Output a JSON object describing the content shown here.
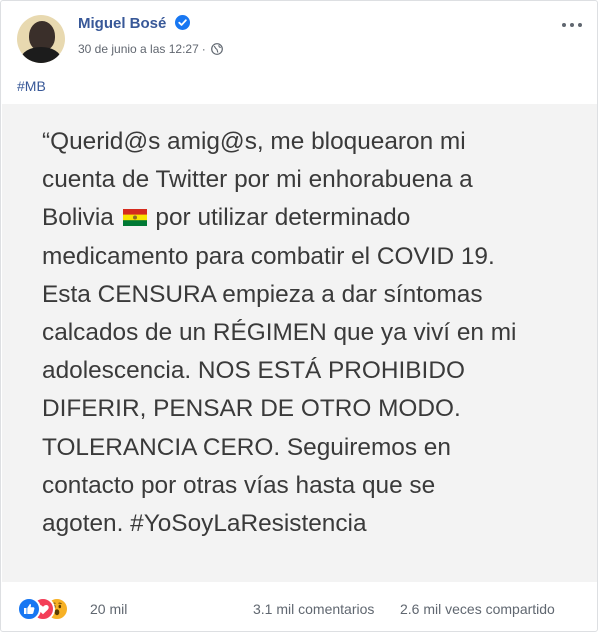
{
  "post": {
    "author": "Miguel Bosé",
    "timestamp": "30 de junio a las 12:27",
    "separator": "·",
    "privacy_icon": "globe-icon",
    "verified_icon": "verified-badge-icon",
    "hashtag": "#MB"
  },
  "image_text": {
    "lines": [
      "“Querid@s amig@s, me bloquearon mi",
      "cuenta de Twitter por mi enhorabuena a",
      "Bolivia",
      " por utilizar determinado",
      "medicamento para combatir el COVID 19.",
      "Esta CENSURA empieza a dar síntomas",
      "calcados de un RÉGIMEN que ya viví en mi",
      "adolescencia. NOS ESTÁ PROHIBIDO",
      "DIFERIR, PENSAR DE OTRO MODO.",
      "TOLERANCIA CERO. Seguiremos en",
      "contacto por otras vías hasta que se",
      "agoten. #YoSoyLaResistencia"
    ],
    "flag_icon": "bolivia-flag-icon"
  },
  "footer": {
    "reaction_icons": [
      "like-icon",
      "love-icon",
      "wow-icon"
    ],
    "reaction_count": "20 mil",
    "comments": "3.1 mil comentarios",
    "shares": "2.6 mil veces compartido"
  },
  "colors": {
    "link": "#385898",
    "meta": "#616770",
    "image_bg": "#f3f3f3",
    "like": "#1877f2",
    "love": "#f33e58",
    "wow": "#f7b125"
  }
}
